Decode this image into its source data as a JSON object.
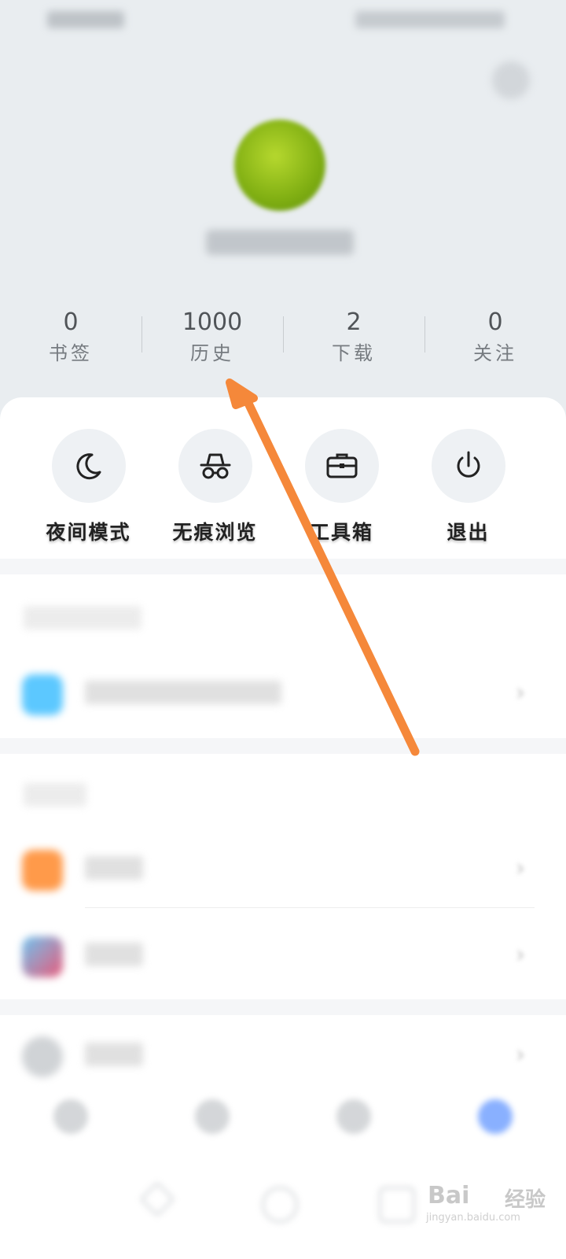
{
  "stats": [
    {
      "value": "0",
      "label": "书签"
    },
    {
      "value": "1000",
      "label": "历史"
    },
    {
      "value": "2",
      "label": "下载"
    },
    {
      "value": "0",
      "label": "关注"
    }
  ],
  "quick_actions": [
    {
      "label": "夜间模式",
      "icon": "moon-icon"
    },
    {
      "label": "无痕浏览",
      "icon": "incognito-icon"
    },
    {
      "label": "工具箱",
      "icon": "toolbox-icon"
    },
    {
      "label": "退出",
      "icon": "power-icon"
    }
  ],
  "annotation": {
    "color": "#f5883a",
    "points_to": "history-stat"
  },
  "watermark": {
    "brand": "Bai",
    "brand2": "经验",
    "url": "jingyan.baidu.com"
  },
  "colors": {
    "header_bg": "#e9edf0",
    "nav_active": "#3b7cff"
  }
}
